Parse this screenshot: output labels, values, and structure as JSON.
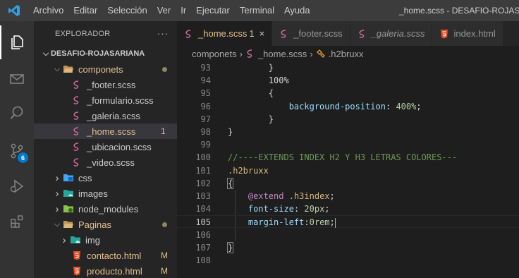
{
  "menu": {
    "items": [
      "Archivo",
      "Editar",
      "Selección",
      "Ver",
      "Ir",
      "Ejecutar",
      "Terminal",
      "Ayuda"
    ],
    "window_title": "_home.scss - DESAFIO-ROJASARI"
  },
  "activity": {
    "source_control_badge": "6"
  },
  "explorer": {
    "title": "EXPLORADOR",
    "more_label": "···",
    "project": "DESAFIO-ROJASARIANA",
    "tree": [
      {
        "label": "componets",
        "type": "folder",
        "open": true,
        "indent": 0,
        "modified_dot": true
      },
      {
        "label": "_footer.scss",
        "type": "scss",
        "indent": 1
      },
      {
        "label": "_formulario.scss",
        "type": "scss",
        "indent": 1
      },
      {
        "label": "_galeria.scss",
        "type": "scss",
        "indent": 1
      },
      {
        "label": "_home.scss",
        "type": "scss",
        "indent": 1,
        "selected": true,
        "badge": "1"
      },
      {
        "label": "_ubicacion.scss",
        "type": "scss",
        "indent": 1
      },
      {
        "label": "_video.scss",
        "type": "scss",
        "indent": 1
      },
      {
        "label": "css",
        "type": "folder-css",
        "open": false,
        "indent": 0
      },
      {
        "label": "images",
        "type": "folder-img",
        "open": false,
        "indent": 0
      },
      {
        "label": "node_modules",
        "type": "folder-node",
        "open": false,
        "indent": 0
      },
      {
        "label": "Paginas",
        "type": "folder",
        "open": true,
        "indent": 0,
        "modified_dot": true
      },
      {
        "label": "img",
        "type": "folder-img",
        "open": false,
        "indent": 1
      },
      {
        "label": "contacto.html",
        "type": "html",
        "indent": 1,
        "badge": "M"
      },
      {
        "label": "producto.html",
        "type": "html",
        "indent": 1,
        "badge": "M"
      }
    ]
  },
  "tabs": [
    {
      "label": "_home.scss",
      "count": "1",
      "close": "×",
      "active": true,
      "icon": "scss"
    },
    {
      "label": "_footer.scss",
      "active": false,
      "icon": "scss"
    },
    {
      "label": "_galeria.scss",
      "active": false,
      "icon": "scss"
    },
    {
      "label": "index.html",
      "active": false,
      "icon": "html"
    }
  ],
  "breadcrumb": {
    "folder": "componets",
    "file": "_home.scss",
    "symbol": ".h2bruxx",
    "sep": "›"
  },
  "editor": {
    "current_line": "105",
    "lines": [
      {
        "n": "93",
        "tokens": [
          [
            "        ",
            "punct"
          ],
          [
            "}",
            "punct"
          ]
        ]
      },
      {
        "n": "94",
        "tokens": [
          [
            "        ",
            "punct"
          ],
          [
            "100%",
            "punct"
          ]
        ]
      },
      {
        "n": "95",
        "tokens": [
          [
            "        ",
            "punct"
          ],
          [
            "{",
            "punct"
          ]
        ]
      },
      {
        "n": "96",
        "tokens": [
          [
            "            ",
            "punct"
          ],
          [
            "background-position",
            "prop"
          ],
          [
            ": ",
            "punct"
          ],
          [
            "400%",
            "num"
          ],
          [
            ";",
            "punct"
          ]
        ]
      },
      {
        "n": "97",
        "tokens": [
          [
            "        ",
            "punct"
          ],
          [
            "}",
            "punct"
          ]
        ]
      },
      {
        "n": "98",
        "tokens": [
          [
            "}",
            "punct"
          ]
        ]
      },
      {
        "n": "99",
        "tokens": []
      },
      {
        "n": "100",
        "tokens": [
          [
            "//----EXTENDS INDEX H2 Y H3 LETRAS COLORES---",
            "comment"
          ]
        ]
      },
      {
        "n": "101",
        "tokens": [
          [
            ".h2bruxx",
            "sel"
          ]
        ]
      },
      {
        "n": "102",
        "tokens": [
          [
            "{",
            "brace"
          ]
        ]
      },
      {
        "n": "103",
        "tokens": [
          [
            "    ",
            "punct"
          ],
          [
            "@extend",
            "at"
          ],
          [
            " ",
            "punct"
          ],
          [
            ".h3index",
            "sel"
          ],
          [
            ";",
            "punct"
          ]
        ]
      },
      {
        "n": "104",
        "tokens": [
          [
            "    ",
            "punct"
          ],
          [
            "font-size",
            "prop"
          ],
          [
            ": ",
            "punct"
          ],
          [
            "20px",
            "num"
          ],
          [
            ";",
            "punct"
          ]
        ]
      },
      {
        "n": "105",
        "tokens": [
          [
            "    ",
            "punct"
          ],
          [
            "margin-left",
            "prop"
          ],
          [
            ":",
            "punct"
          ],
          [
            "0rem",
            "num"
          ],
          [
            ";",
            "punct"
          ],
          [
            "",
            "cursor"
          ]
        ]
      },
      {
        "n": "106",
        "tokens": []
      },
      {
        "n": "107",
        "tokens": [
          [
            "}",
            "brace"
          ]
        ]
      },
      {
        "n": "108",
        "tokens": []
      }
    ]
  }
}
